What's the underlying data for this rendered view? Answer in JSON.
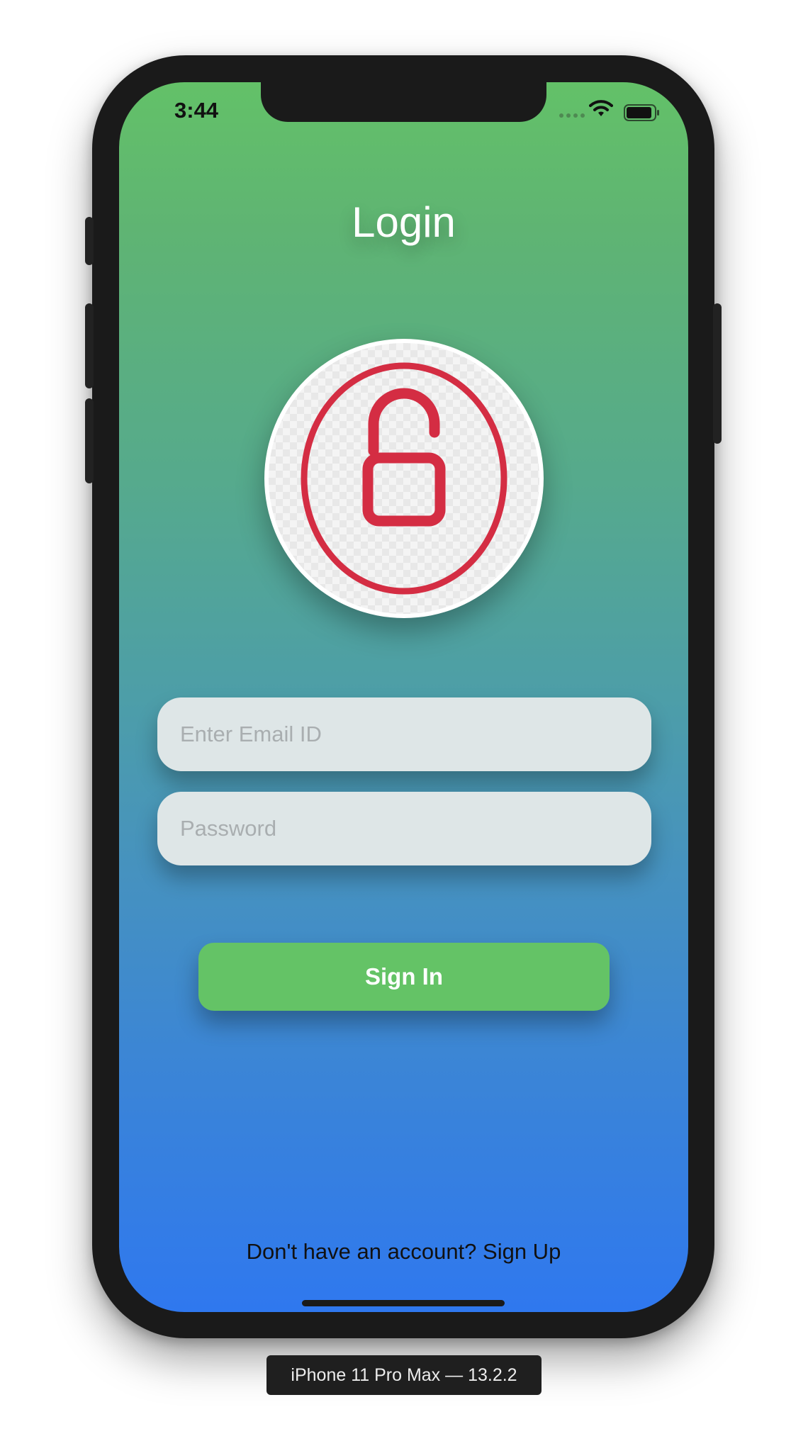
{
  "status_bar": {
    "time": "3:44"
  },
  "screen": {
    "title": "Login",
    "logo_icon": "unlocked-padlock-icon",
    "email": {
      "placeholder": "Enter Email ID",
      "value": ""
    },
    "password": {
      "placeholder": "Password",
      "value": ""
    },
    "sign_in_label": "Sign In",
    "footer_text": "Don't have an account? Sign Up"
  },
  "simulator_label": "iPhone 11 Pro Max — 13.2.2",
  "colors": {
    "gradient_top": "#63c168",
    "gradient_bottom": "#2f78ef",
    "button_green": "#64c366",
    "field_bg": "#dee6e7",
    "icon_red": "#d42d43"
  }
}
